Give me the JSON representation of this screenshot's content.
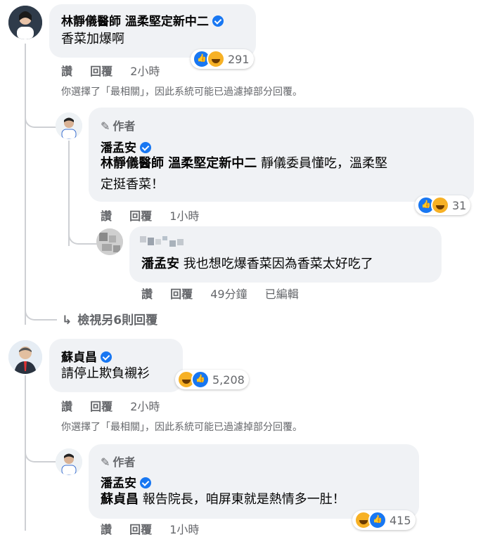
{
  "comments": [
    {
      "author": "林靜儀醫師 溫柔堅定新中二",
      "text": "香菜加爆啊",
      "reactions": [
        "like",
        "haha"
      ],
      "reaction_count": "291",
      "actions": {
        "like": "讚",
        "reply": "回覆",
        "time": "2小時"
      },
      "filter_note": "你選擇了「最相關」，因此系統可能已過濾掉部分回覆。"
    },
    {
      "badge": "作者",
      "author": "潘孟安",
      "mention": "林靜儀醫師 溫柔堅定新中二",
      "text_line1": "靜儀委員懂吃，溫柔堅",
      "text_line2": "定挺香菜！",
      "reactions": [
        "like",
        "haha"
      ],
      "reaction_count": "31",
      "actions": {
        "like": "讚",
        "reply": "回覆",
        "time": "1小時"
      }
    },
    {
      "mention": "潘孟安",
      "text": "我也想吃爆香菜因為香菜太好吃了",
      "actions": {
        "like": "讚",
        "reply": "回覆",
        "time": "49分鐘",
        "edited": "已編輯"
      }
    },
    {
      "view_more": "檢視另6則回覆"
    },
    {
      "author": "蘇貞昌",
      "text": "請停止欺負襯衫",
      "reactions": [
        "haha",
        "like"
      ],
      "reaction_count": "5,208",
      "actions": {
        "like": "讚",
        "reply": "回覆",
        "time": "2小時"
      },
      "filter_note": "你選擇了「最相關」，因此系統可能已過濾掉部分回覆。"
    },
    {
      "badge": "作者",
      "author": "潘孟安",
      "mention": "蘇貞昌",
      "text": "報告院長，咱屏東就是熱情多一肚！",
      "reactions": [
        "haha",
        "like"
      ],
      "reaction_count": "415",
      "actions": {
        "like": "讚",
        "reply": "回覆",
        "time": "1小時"
      }
    }
  ],
  "colors": {
    "bubble": "#f0f2f5",
    "link": "#1877f2",
    "muted": "#65676b"
  }
}
